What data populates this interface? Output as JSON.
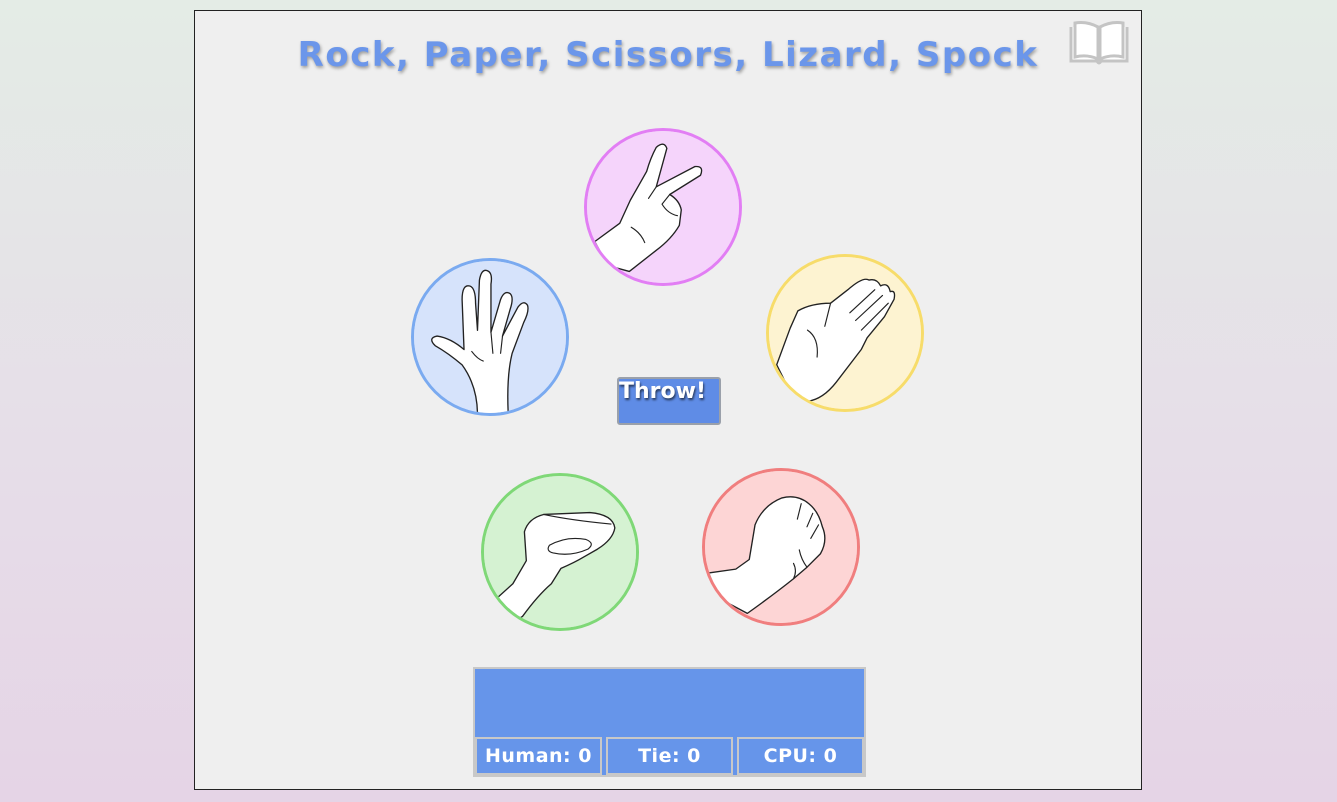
{
  "title": "Rock, Paper, Scissors, Lizard, Spock",
  "rules_icon": "open-book-icon",
  "choices": {
    "scissors": {
      "color": "#f5d4fb",
      "border": "#e27ef4"
    },
    "spock": {
      "color": "#d6e3fb",
      "border": "#7aaaf0"
    },
    "paper": {
      "color": "#fdf3d1",
      "border": "#f7dc6a"
    },
    "lizard": {
      "color": "#d5f2d2",
      "border": "#7fd877"
    },
    "rock": {
      "color": "#fdd5d5",
      "border": "#f07e7e"
    }
  },
  "throw_label": "Throw!",
  "result_text": "",
  "scores": {
    "human": "Human: 0",
    "tie": "Tie: 0",
    "cpu": "CPU: 0"
  }
}
